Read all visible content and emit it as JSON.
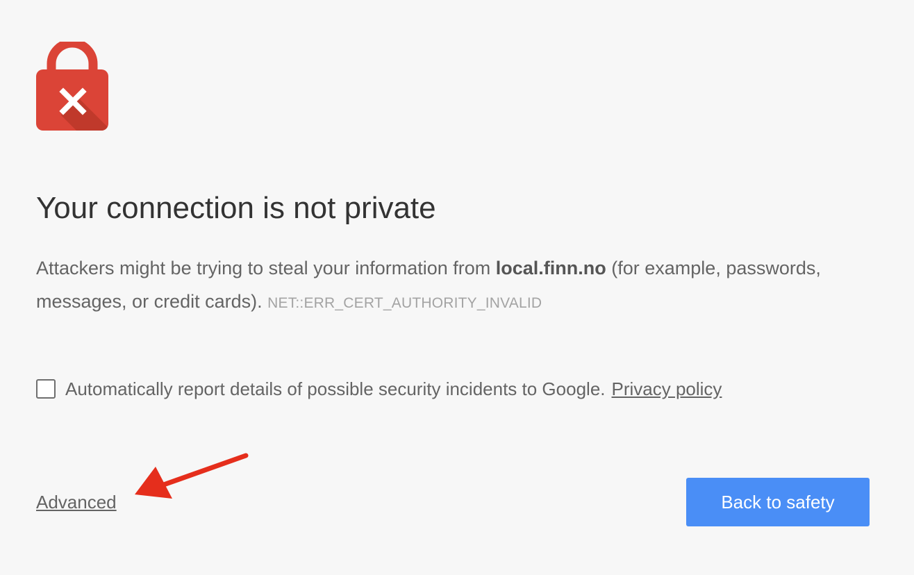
{
  "icon": "lock-error-icon",
  "annotation_arrow_icon": "red-arrow-icon",
  "colors": {
    "background": "#f7f7f7",
    "lock_red": "#db4437",
    "button_blue": "#4a8ef6",
    "arrow_red": "#e52e1c"
  },
  "heading": "Your connection is not private",
  "message": {
    "prefix": "Attackers might be trying to steal your information from ",
    "host": "local.finn.no",
    "suffix": " (for example, passwords, messages, or credit cards).",
    "error_code": "NET::ERR_CERT_AUTHORITY_INVALID"
  },
  "report": {
    "checked": false,
    "text": "Automatically report details of possible security incidents to Google.",
    "privacy_link": "Privacy policy"
  },
  "advanced_link": "Advanced",
  "back_button": "Back to safety"
}
